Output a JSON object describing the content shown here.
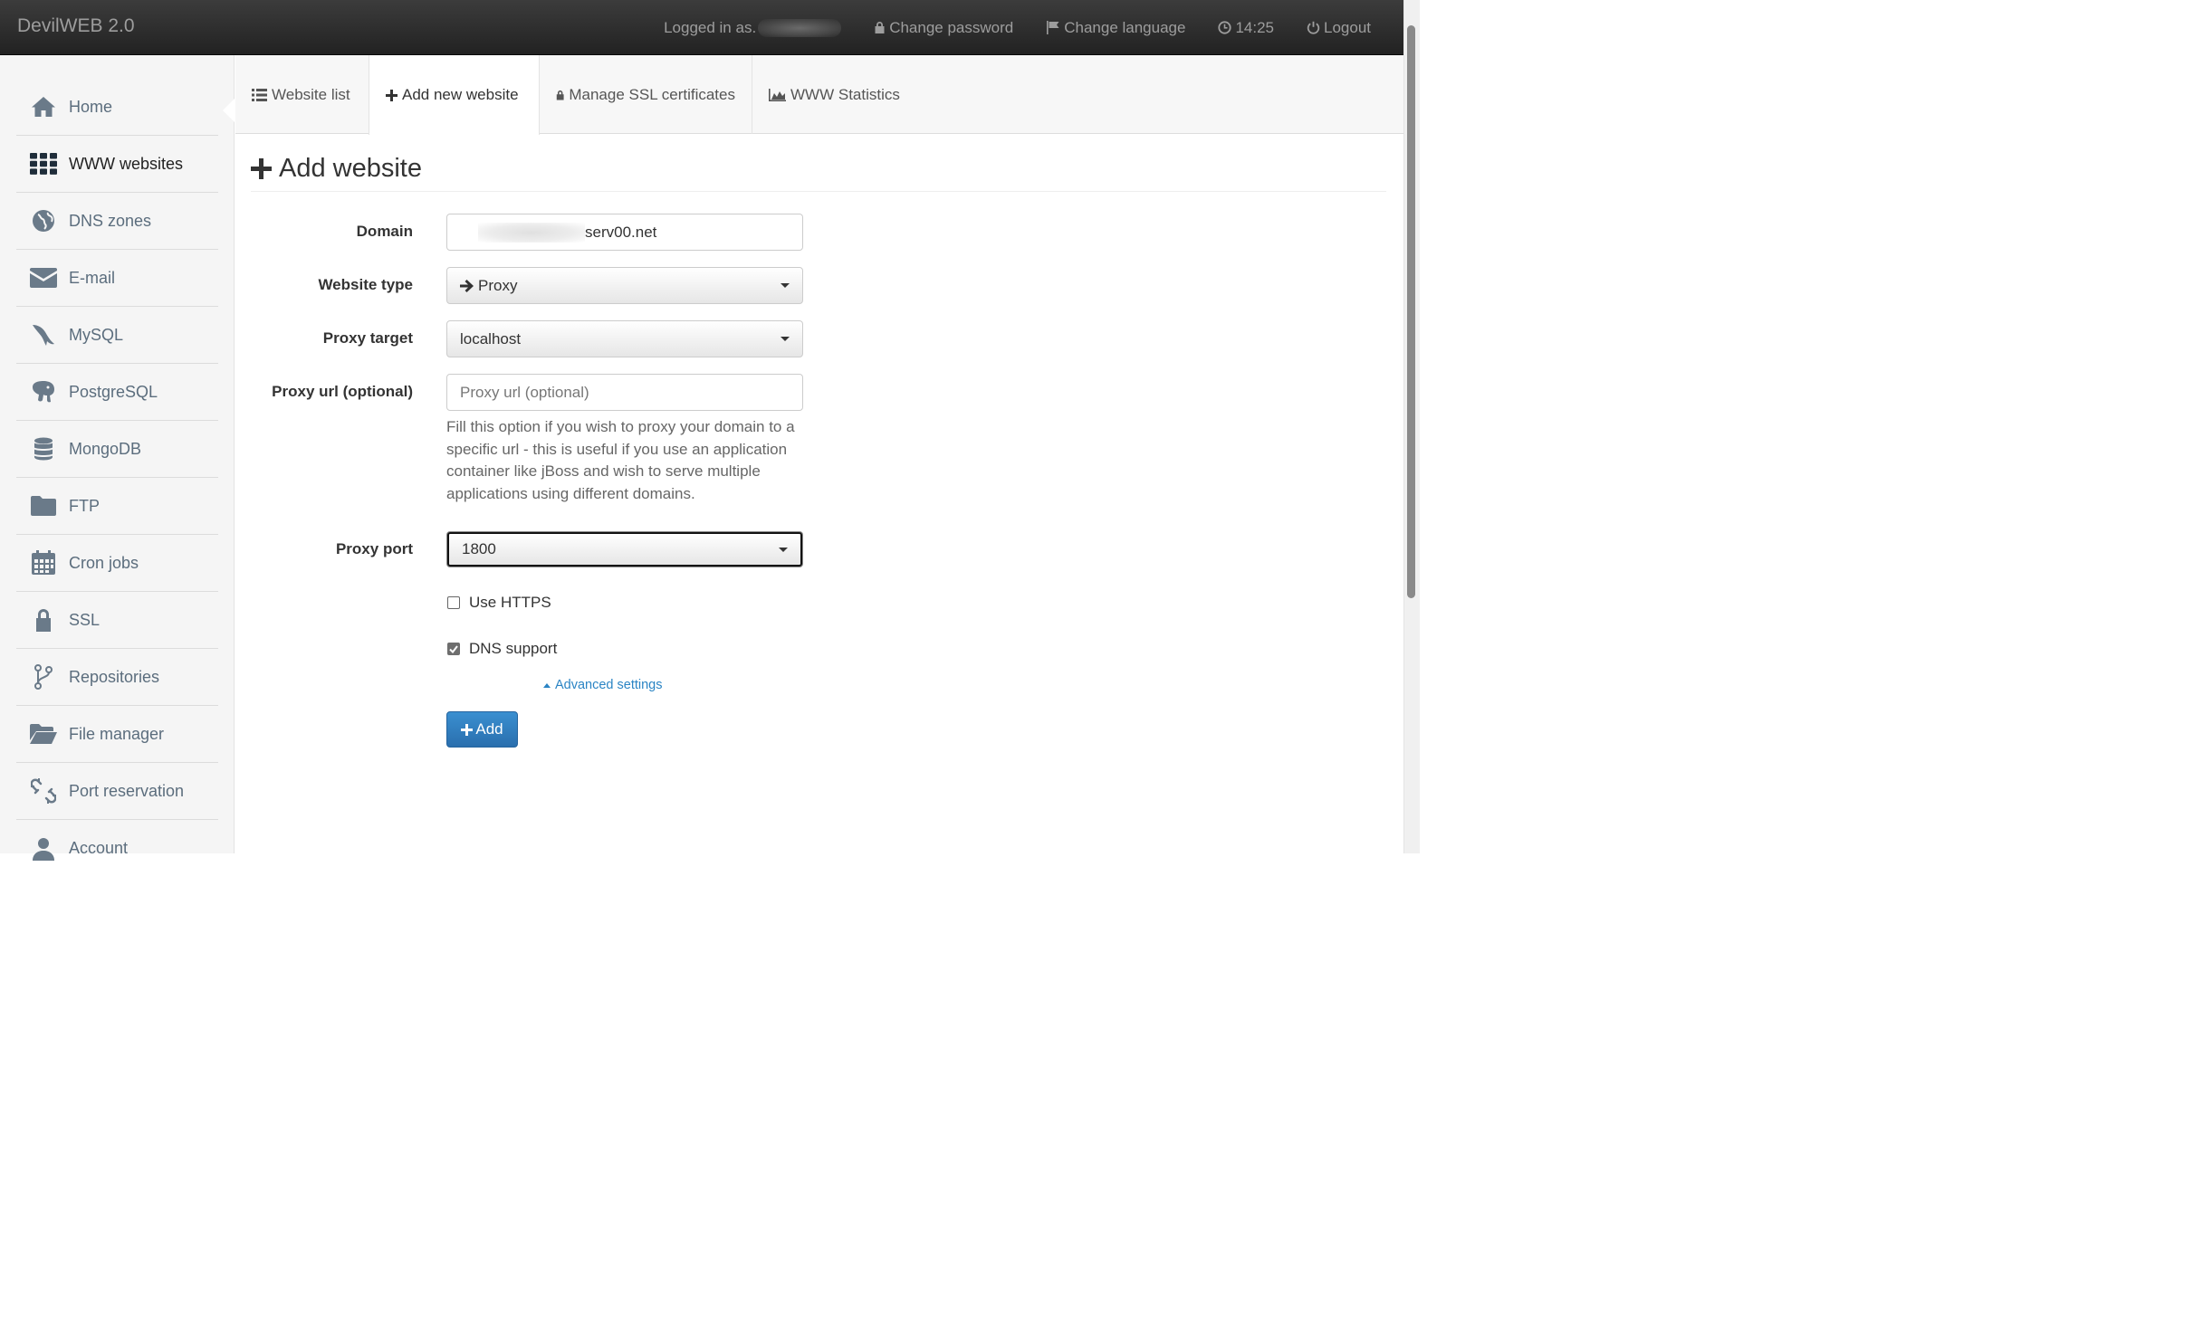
{
  "header": {
    "brand": "DevilWEB 2.0",
    "logged_in_label": "Logged in as",
    "change_password": "Change password",
    "change_language": "Change language",
    "time": "14:25",
    "logout": "Logout"
  },
  "sidebar": {
    "items": [
      {
        "label": "Home",
        "icon": "home-icon"
      },
      {
        "label": "WWW websites",
        "icon": "grid-icon",
        "active": true
      },
      {
        "label": "DNS zones",
        "icon": "globe-icon"
      },
      {
        "label": "E-mail",
        "icon": "envelope-icon"
      },
      {
        "label": "MySQL",
        "icon": "mysql-dolphin-icon"
      },
      {
        "label": "PostgreSQL",
        "icon": "postgresql-elephant-icon"
      },
      {
        "label": "MongoDB",
        "icon": "database-icon"
      },
      {
        "label": "FTP",
        "icon": "folder-icon"
      },
      {
        "label": "Cron jobs",
        "icon": "calendar-icon"
      },
      {
        "label": "SSL",
        "icon": "lock-icon"
      },
      {
        "label": "Repositories",
        "icon": "branch-icon"
      },
      {
        "label": "File manager",
        "icon": "folder-open-icon"
      },
      {
        "label": "Port reservation",
        "icon": "unlink-icon"
      },
      {
        "label": "Account",
        "icon": "user-icon"
      }
    ]
  },
  "tabs": {
    "website_list": "Website list",
    "add_new_website": "Add new website",
    "manage_ssl": "Manage SSL certificates",
    "www_statistics": "WWW Statistics"
  },
  "form": {
    "title": "Add website",
    "domain_label": "Domain",
    "domain_value": "serv00.net",
    "website_type_label": "Website type",
    "website_type_value": "Proxy",
    "proxy_target_label": "Proxy target",
    "proxy_target_value": "localhost",
    "proxy_url_label": "Proxy url (optional)",
    "proxy_url_placeholder": "Proxy url (optional)",
    "proxy_url_help": "Fill this option if you wish to proxy your domain to a specific url - this is useful if you use an application container like jBoss and wish to serve multiple applications using different domains.",
    "proxy_port_label": "Proxy port",
    "proxy_port_value": "1800",
    "use_https_label": "Use HTTPS",
    "use_https_checked": false,
    "dns_support_label": "DNS support",
    "dns_support_checked": true,
    "advanced_settings": "Advanced settings",
    "add_button": "Add"
  },
  "colors": {
    "topbar": "#222222",
    "sidebar_bg": "#f5f5f5",
    "link": "#2a84c4",
    "primary_button": "#2f7ec1"
  }
}
